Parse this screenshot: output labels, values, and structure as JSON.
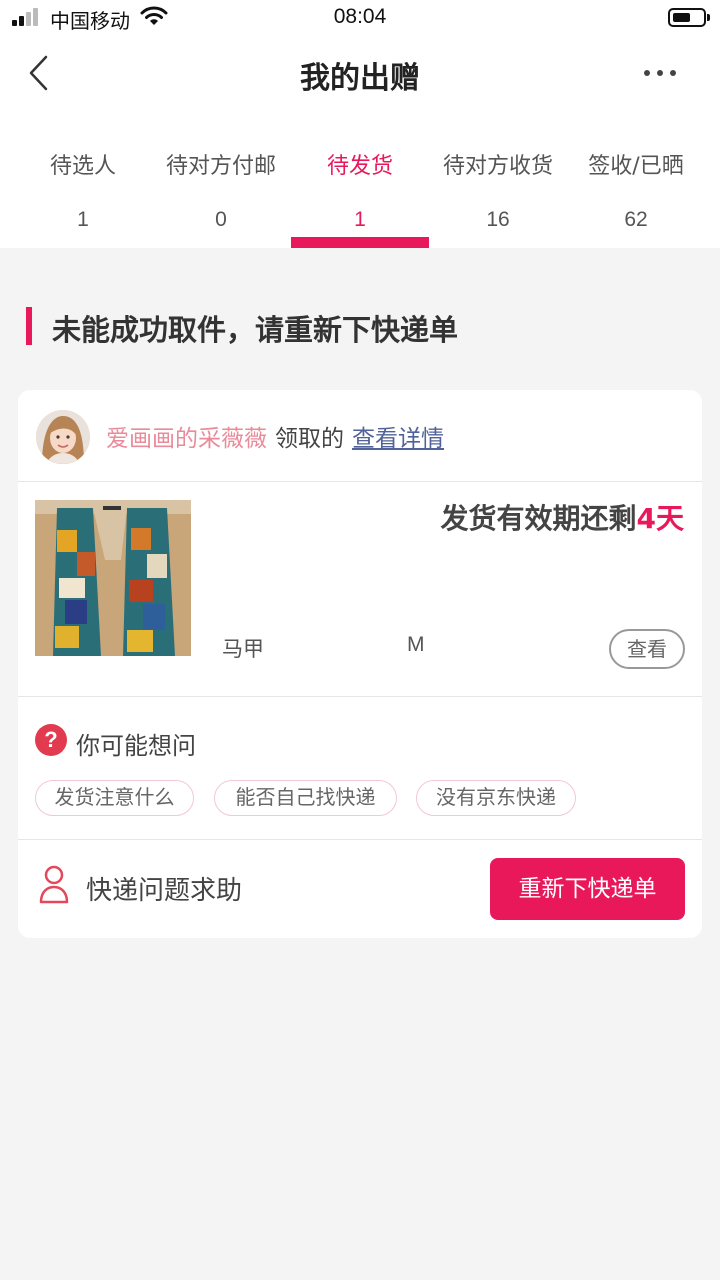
{
  "status_bar": {
    "carrier": "中国移动",
    "time": "08:04"
  },
  "nav": {
    "title": "我的出赠",
    "back_icon": "chevron-left-icon",
    "more_icon": "more-dots-icon"
  },
  "tabs": [
    {
      "label": "待选人",
      "count": "1"
    },
    {
      "label": "待对方付邮",
      "count": "0"
    },
    {
      "label": "待发货",
      "count": "1"
    },
    {
      "label": "待对方收货",
      "count": "16"
    },
    {
      "label": "签收/已晒",
      "count": "62"
    }
  ],
  "active_tab": 2,
  "section": {
    "title": "未能成功取件，请重新下快递单"
  },
  "order": {
    "receiver_name": "爱画画的采薇薇",
    "receiver_suffix": "领取的",
    "detail_link": "查看详情",
    "expiry_prefix": "发货有效期还剩",
    "expiry_days": "4天",
    "product_name": "马甲",
    "product_size": "M",
    "view_label": "查看"
  },
  "faq": {
    "title": "你可能想问",
    "icon": "question-circle-icon",
    "chips": [
      "发货注意什么",
      "能否自己找快递",
      "没有京东快递"
    ]
  },
  "help": {
    "label": "快递问题求助",
    "icon": "person-icon"
  },
  "reorder_button": "重新下快递单",
  "colors": {
    "accent": "#e8185a",
    "receiver_name": "#e98b9a",
    "link": "#51629a",
    "background": "#f4f4f4"
  }
}
